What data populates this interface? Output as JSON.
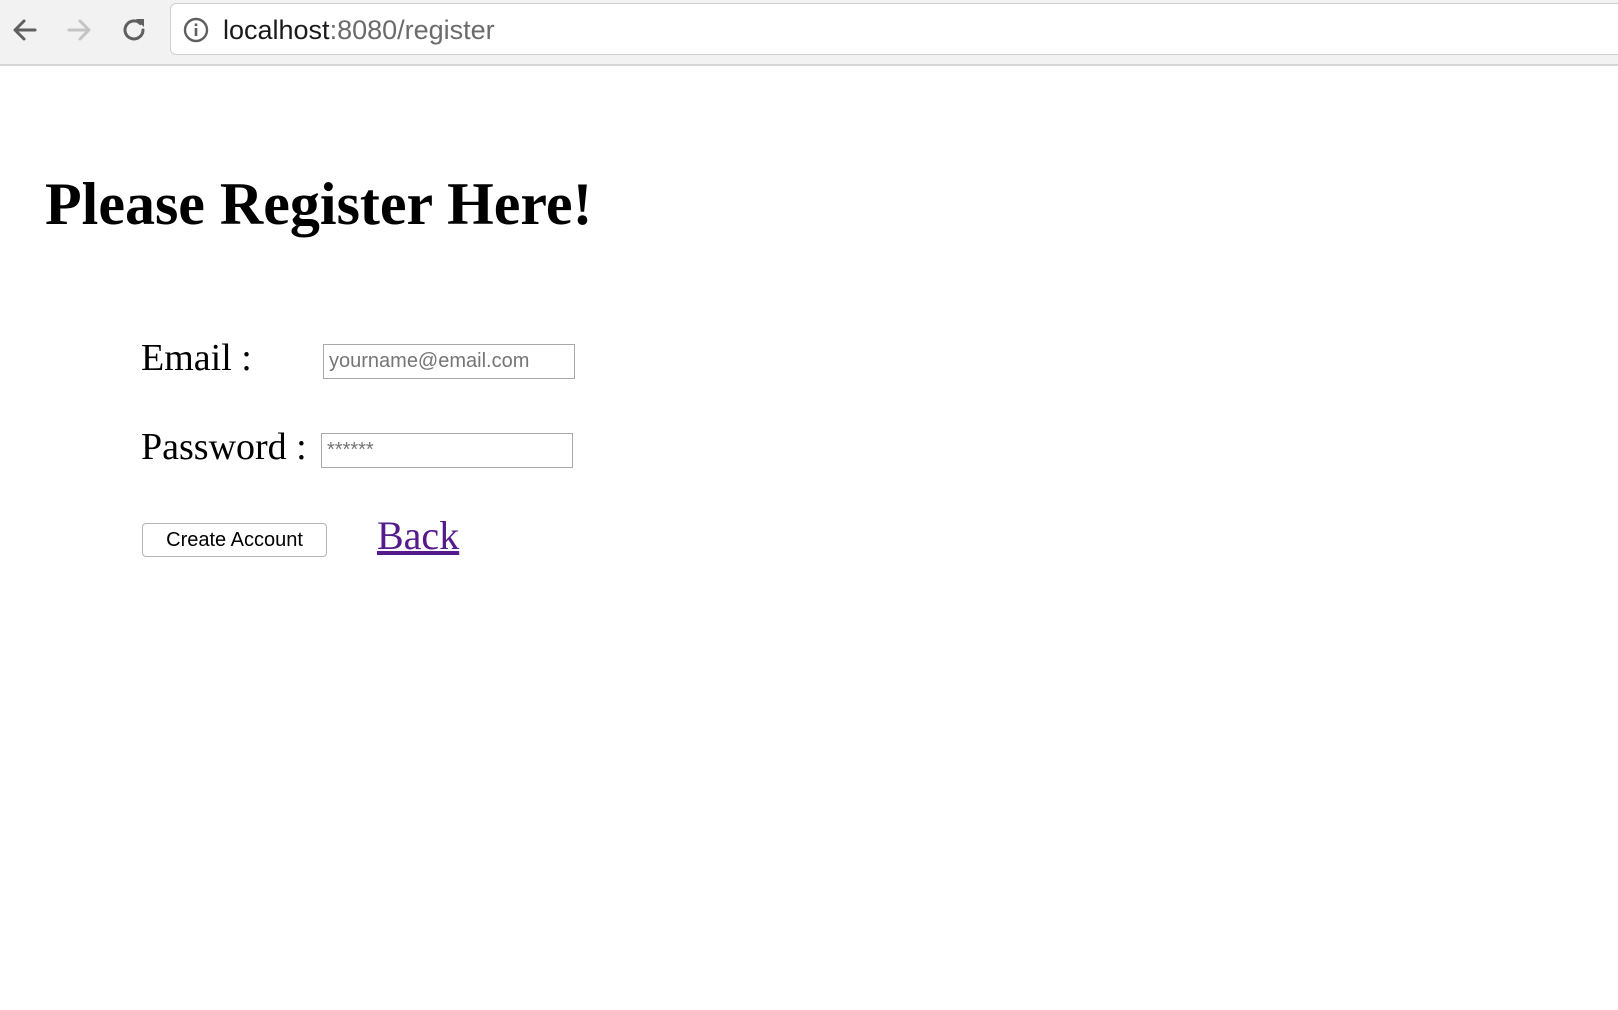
{
  "browser": {
    "back_icon": "arrow-left-icon",
    "forward_icon": "arrow-right-icon",
    "reload_icon": "reload-icon",
    "site_info_icon": "info-icon",
    "url_host": "localhost",
    "url_rest": ":8080/register"
  },
  "page": {
    "title": "Please Register Here!",
    "email_label": "Email :",
    "email_placeholder": "yourname@email.com",
    "password_label": "Password :",
    "password_placeholder": "******",
    "create_button_label": "Create Account",
    "back_link_label": "Back"
  },
  "colors": {
    "visited_link": "#551a8b",
    "toolbar_bg": "#f2f2f2"
  }
}
